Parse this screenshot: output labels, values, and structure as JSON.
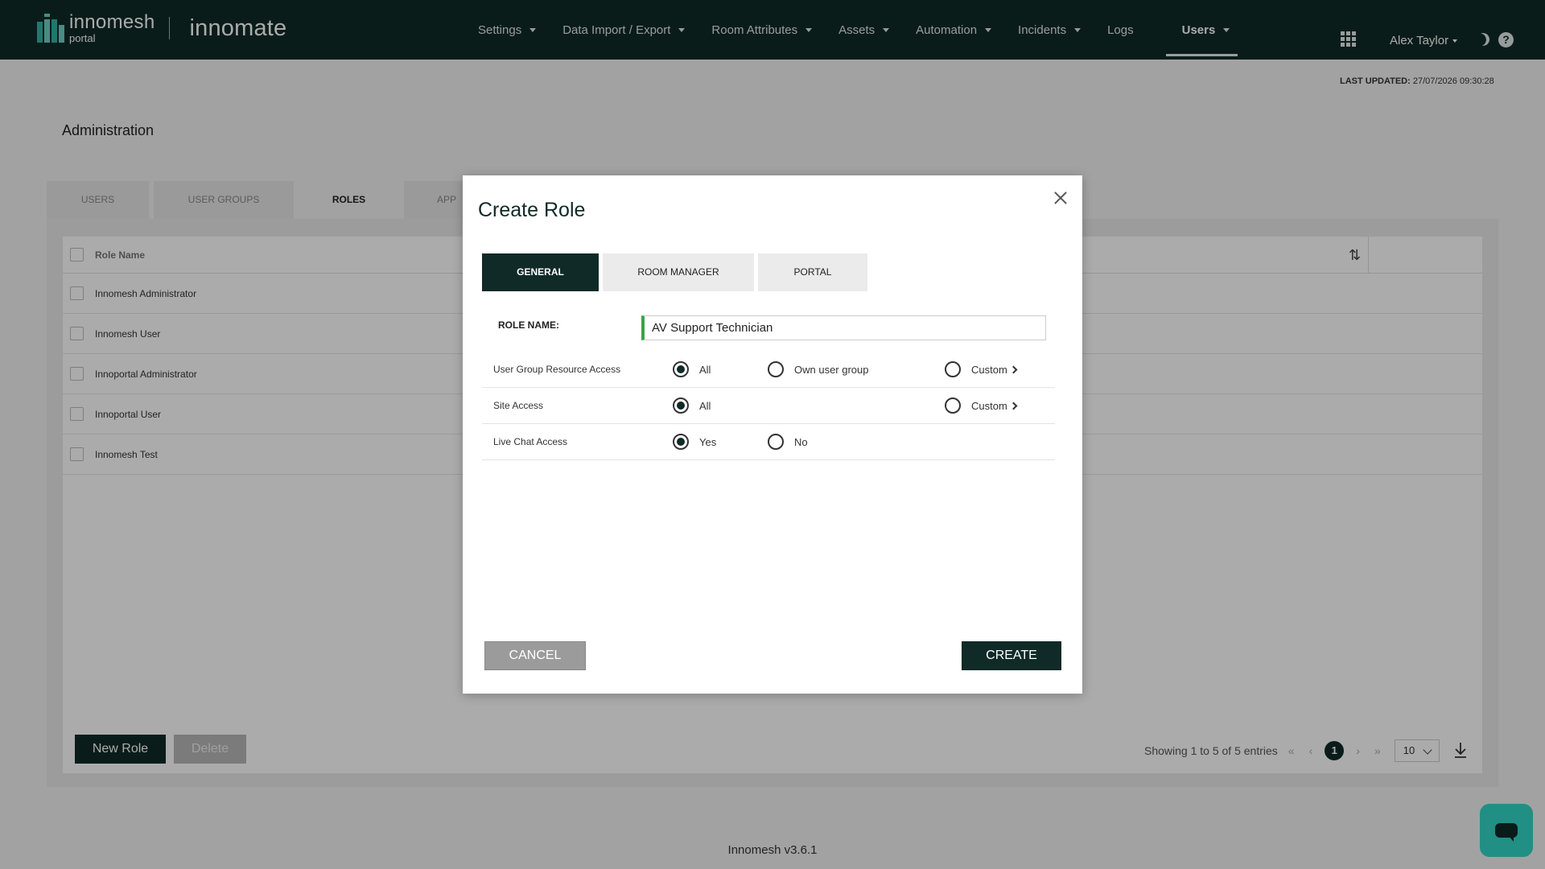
{
  "brand": {
    "logo_name": "innomesh",
    "logo_sub": "portal",
    "product": "innomate",
    "accent_color": "#2fb3a4",
    "nav_bg": "#0f2a27"
  },
  "nav": {
    "items": [
      {
        "label": "Settings",
        "dropdown": true
      },
      {
        "label": "Data Import / Export",
        "dropdown": true
      },
      {
        "label": "Room Attributes",
        "dropdown": true
      },
      {
        "label": "Assets",
        "dropdown": true
      },
      {
        "label": "Automation",
        "dropdown": true
      },
      {
        "label": "Incidents",
        "dropdown": true
      },
      {
        "label": "Logs",
        "dropdown": false
      },
      {
        "label": "Users",
        "dropdown": true,
        "active": true
      }
    ],
    "apps_icon": "grid-icon",
    "user_name": "Alex Taylor",
    "theme_icon": "moon-icon",
    "help_icon": "help-icon",
    "help_glyph": "?"
  },
  "last_updated": {
    "label": "LAST UPDATED:",
    "value": "27/07/2026 09:30:28"
  },
  "page": {
    "title": "Administration",
    "tabs": [
      {
        "label": "USERS",
        "active": false
      },
      {
        "label": "USER GROUPS",
        "active": false
      },
      {
        "label": "ROLES",
        "active": true
      },
      {
        "label": "APP",
        "active": false
      }
    ]
  },
  "table": {
    "column_header": "Role Name",
    "sort_icon": "sort-icon",
    "rows": [
      {
        "name": "Innomesh Administrator"
      },
      {
        "name": "Innomesh User"
      },
      {
        "name": "Innoportal Administrator"
      },
      {
        "name": "Innoportal User"
      },
      {
        "name": "Innomesh Test"
      }
    ]
  },
  "actions": {
    "new_role": "New Role",
    "delete": "Delete"
  },
  "pagination": {
    "summary": "Showing 1 to 5 of 5 entries",
    "first": "«",
    "prev": "‹",
    "current_page": "1",
    "next": "›",
    "last": "»",
    "page_size": "10"
  },
  "footer": {
    "version": "Innomesh v3.6.1"
  },
  "modal": {
    "title": "Create Role",
    "tabs": [
      {
        "label": "GENERAL",
        "active": true
      },
      {
        "label": "ROOM MANAGER",
        "active": false
      },
      {
        "label": "PORTAL",
        "active": false
      }
    ],
    "role_name_label": "ROLE NAME:",
    "role_name_value": "AV Support Technician",
    "permissions": [
      {
        "label": "User Group Resource Access",
        "options": [
          {
            "label": "All",
            "checked": true
          },
          {
            "label": "Own user group",
            "checked": false
          },
          {
            "label": "Custom",
            "checked": false,
            "has_chevron": true
          }
        ]
      },
      {
        "label": "Site Access",
        "options": [
          {
            "label": "All",
            "checked": true
          },
          {
            "label": "Custom",
            "checked": false,
            "has_chevron": true
          }
        ]
      },
      {
        "label": "Live Chat Access",
        "options": [
          {
            "label": "Yes",
            "checked": true
          },
          {
            "label": "No",
            "checked": false
          }
        ]
      }
    ],
    "cancel_label": "CANCEL",
    "create_label": "CREATE",
    "close_icon": "close-icon"
  },
  "chat": {
    "icon": "chat-bubble-icon",
    "color": "#34d6c5"
  }
}
